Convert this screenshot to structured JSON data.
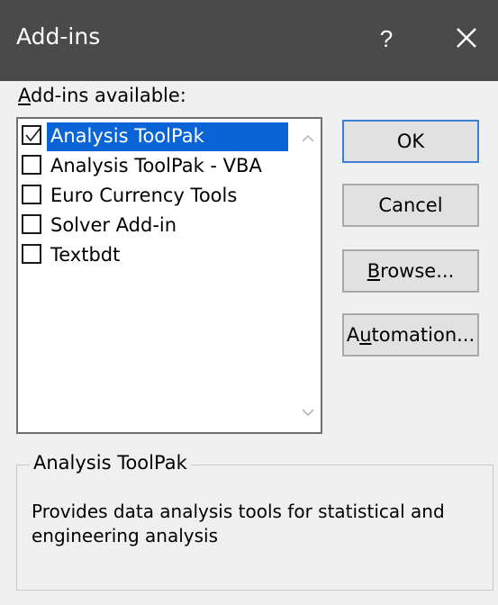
{
  "window": {
    "title": "Add-ins",
    "help_label": "?",
    "close_icon": "close-icon"
  },
  "list": {
    "caption_underlined": "A",
    "caption_rest": "dd-ins available:",
    "items": [
      {
        "label": "Analysis ToolPak",
        "checked": true,
        "selected": true
      },
      {
        "label": "Analysis ToolPak - VBA",
        "checked": false,
        "selected": false
      },
      {
        "label": "Euro Currency Tools",
        "checked": false,
        "selected": false
      },
      {
        "label": "Solver Add-in",
        "checked": false,
        "selected": false
      },
      {
        "label": "Textbdt",
        "checked": false,
        "selected": false
      }
    ],
    "scroll_up_icon": "chevron-up-icon",
    "scroll_down_icon": "chevron-down-icon"
  },
  "buttons": {
    "ok": "OK",
    "cancel": "Cancel",
    "browse_underlined": "B",
    "browse_rest": "rowse...",
    "automation_pre": "A",
    "automation_underlined": "u",
    "automation_rest": "tomation..."
  },
  "description": {
    "title": "Analysis ToolPak",
    "text": "Provides data analysis tools for statistical and engineering analysis"
  },
  "colors": {
    "titlebar": "#4a4a4a",
    "selection": "#0a64d6",
    "background": "#f0f0f0",
    "default_button_border": "#3c7fd6"
  }
}
